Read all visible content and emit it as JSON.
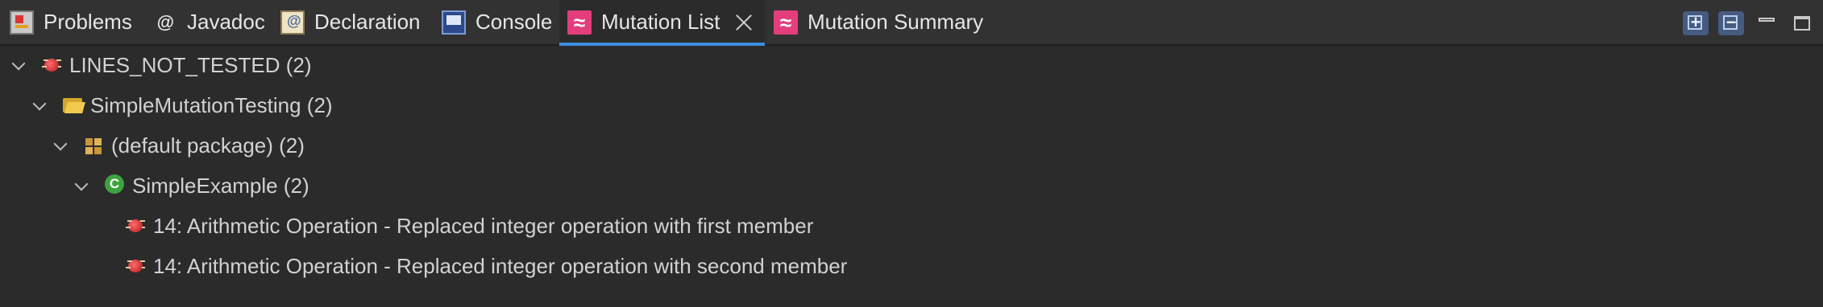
{
  "tabs": [
    {
      "label": "Problems",
      "icon": "problems-icon"
    },
    {
      "label": "Javadoc",
      "icon": "javadoc-icon",
      "glyph": "@"
    },
    {
      "label": "Declaration",
      "icon": "declaration-icon"
    },
    {
      "label": "Console",
      "icon": "console-icon"
    },
    {
      "label": "Mutation List",
      "icon": "mutation-icon",
      "glyph": "≈",
      "active": true
    },
    {
      "label": "Mutation Summary",
      "icon": "mutation-icon",
      "glyph": "≈"
    }
  ],
  "toolbar": {
    "expand_all": "expand-all-icon",
    "collapse_all": "collapse-all-icon",
    "minimize": "minimize-icon",
    "maximize": "maximize-icon"
  },
  "tree": {
    "root": {
      "label": "LINES_NOT_TESTED (2)",
      "icon": "mutation-bug-icon"
    },
    "project": {
      "label": "SimpleMutationTesting (2)",
      "icon": "project-folder-icon"
    },
    "package": {
      "label": "(default package) (2)",
      "icon": "package-icon"
    },
    "class": {
      "label": "SimpleExample (2)",
      "icon": "class-icon"
    },
    "mutations": [
      {
        "label": "14: Arithmetic Operation - Replaced integer operation with first member",
        "icon": "mutation-bug-icon"
      },
      {
        "label": "14: Arithmetic Operation - Replaced integer operation with second member",
        "icon": "mutation-bug-icon"
      }
    ]
  },
  "colors": {
    "background": "#2b2b2b",
    "tabbar": "#323232",
    "active_tab_indicator": "#3d8fe0",
    "mutation_accent": "#e43d7c"
  }
}
